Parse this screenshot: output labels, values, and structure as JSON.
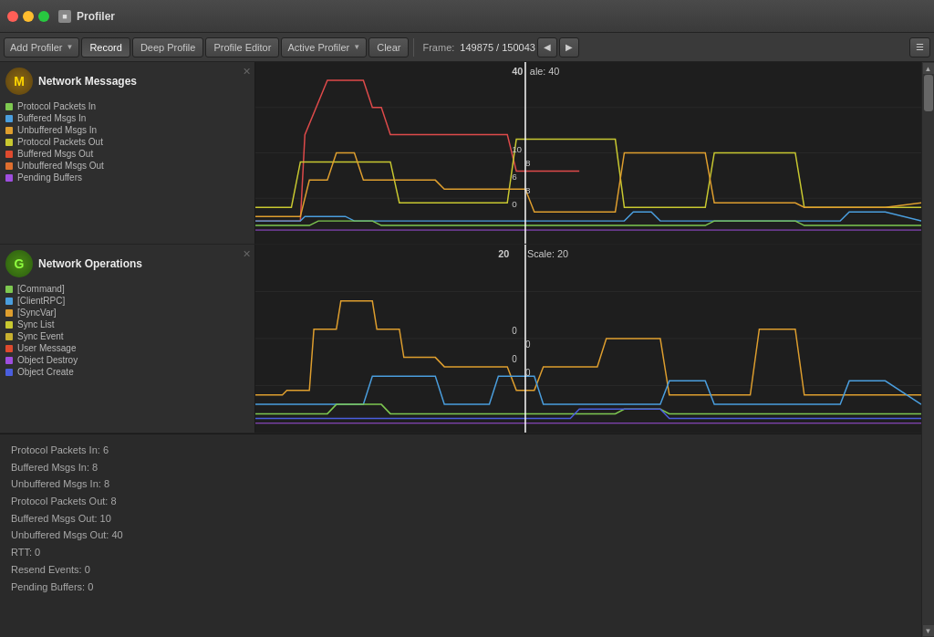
{
  "titleBar": {
    "icon": "■",
    "title": "Profiler"
  },
  "toolbar": {
    "addProfiler": "Add Profiler",
    "record": "Record",
    "deepProfile": "Deep Profile",
    "profileEditor": "Profile Editor",
    "activeProfiler": "Active Profiler",
    "clear": "Clear",
    "frameLabel": "Frame:",
    "frameValue": "149875 / 150043",
    "navPrev": "◀",
    "navNext": "▶",
    "menu": "☰"
  },
  "panels": [
    {
      "id": "network-messages",
      "iconLetter": "M",
      "iconClass": "icon-m",
      "title": "Network Messages",
      "scaleTop": "40 ale: 40",
      "scaleValues": [
        "10",
        "8",
        "6",
        "8",
        "0"
      ],
      "legendItems": [
        {
          "color": "#7ec850",
          "label": "Protocol Packets In"
        },
        {
          "color": "#4a9ede",
          "label": "Buffered Msgs In"
        },
        {
          "color": "#de9e2e",
          "label": "Unbuffered Msgs In"
        },
        {
          "color": "#c8c830",
          "label": "Protocol Packets Out"
        },
        {
          "color": "#de4a2e",
          "label": "Buffered Msgs Out"
        },
        {
          "color": "#de6e2e",
          "label": "Unbuffered Msgs Out"
        },
        {
          "color": "#9e4ede",
          "label": "Pending Buffers"
        }
      ]
    },
    {
      "id": "network-operations",
      "iconLetter": "G",
      "iconClass": "icon-g",
      "title": "Network Operations",
      "scaleTop": "20  Scale: 20",
      "scaleValues": [
        "0",
        "0",
        "0",
        "0"
      ],
      "legendItems": [
        {
          "color": "#7ec850",
          "label": "[Command]"
        },
        {
          "color": "#4a9ede",
          "label": "[ClientRPC]"
        },
        {
          "color": "#de9e2e",
          "label": "[SyncVar]"
        },
        {
          "color": "#c8c830",
          "label": "Sync List"
        },
        {
          "color": "#c8c830",
          "label": "Sync Event"
        },
        {
          "color": "#de4a2e",
          "label": "User Message"
        },
        {
          "color": "#9e4ede",
          "label": "Object Destroy"
        },
        {
          "color": "#4a5ede",
          "label": "Object Create"
        }
      ]
    }
  ],
  "stats": {
    "lines": [
      "Protocol Packets In: 6",
      "Buffered Msgs In: 8",
      "Unbuffered Msgs In: 8",
      "Protocol Packets Out: 8",
      "Buffered Msgs Out: 10",
      "Unbuffered Msgs Out: 40",
      "RTT: 0",
      "Resend Events: 0",
      "Pending Buffers: 0"
    ]
  }
}
